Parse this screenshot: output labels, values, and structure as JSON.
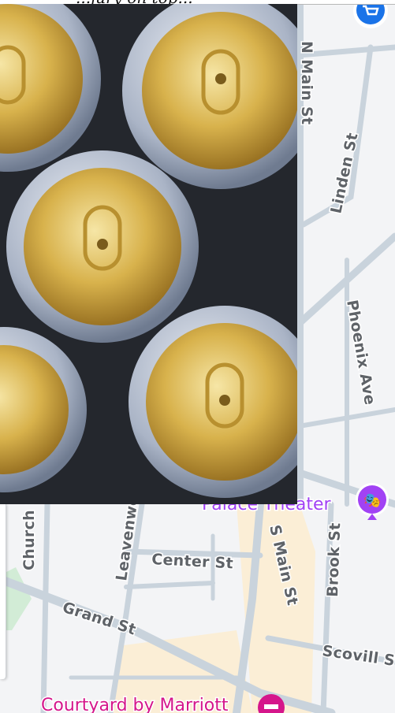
{
  "header": {
    "text": "...jury on top..."
  },
  "photo": {
    "subject": "top-down-beverage-cans-photo"
  },
  "map": {
    "streets": [
      {
        "id": "n-main-st",
        "label": "N Main St"
      },
      {
        "id": "linden-st",
        "label": "Linden St"
      },
      {
        "id": "phoenix-ave",
        "label": "Phoenix Ave"
      },
      {
        "id": "church-st",
        "label": "Church St"
      },
      {
        "id": "leavenworth-st",
        "label": "Leavenworth St"
      },
      {
        "id": "center-st",
        "label": "Center St"
      },
      {
        "id": "s-main-st",
        "label": "S Main St"
      },
      {
        "id": "brook-st",
        "label": "Brook St"
      },
      {
        "id": "grand-st",
        "label": "Grand St"
      },
      {
        "id": "scovill-st",
        "label": "Scovill St"
      }
    ],
    "pois": [
      {
        "id": "palace-theater",
        "label": "Palace Theater",
        "icon": "theater-masks-icon",
        "color": "#a142f4"
      },
      {
        "id": "courtyard-marriott",
        "label": "Courtyard by Marriott",
        "icon": "hotel-bed-icon",
        "color": "#d5168b"
      },
      {
        "id": "shopping",
        "label": "",
        "icon": "shopping-cart-icon",
        "color": "#1a73e8"
      }
    ],
    "colors": {
      "land": "#f3f4f6",
      "road": "#c9d3dc",
      "park": "#d2ecd6",
      "campus": "#fbeed6"
    }
  }
}
